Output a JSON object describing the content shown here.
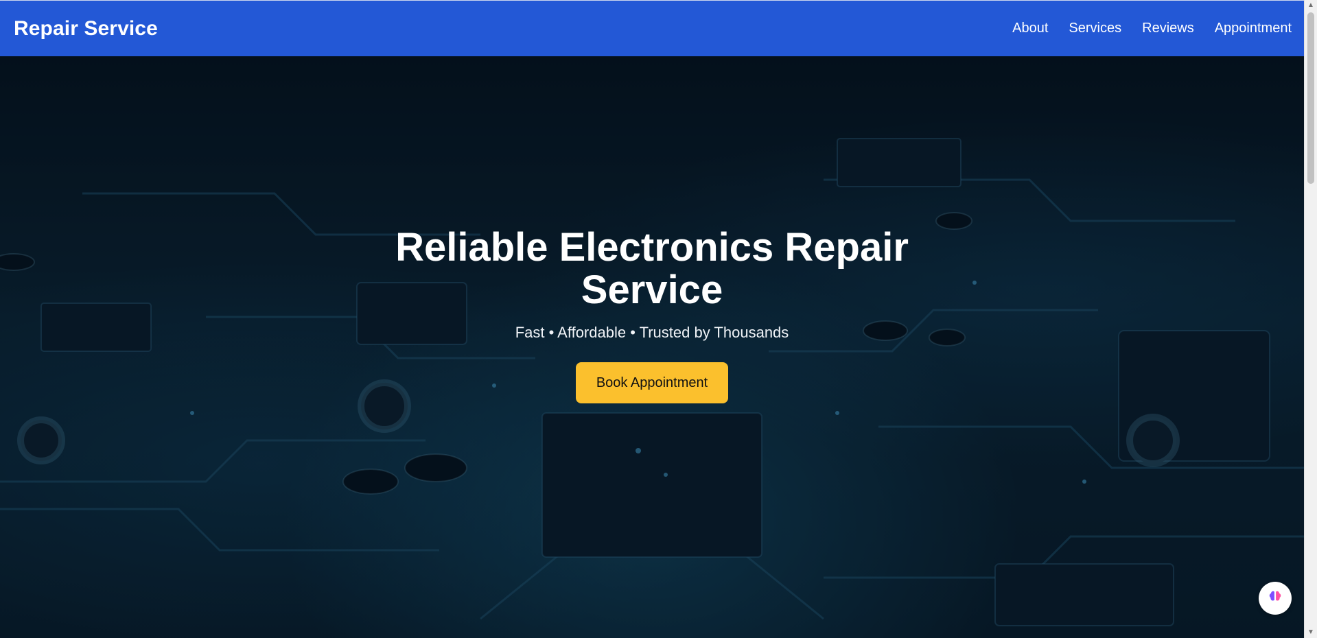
{
  "header": {
    "brand": "Repair Service",
    "nav": [
      {
        "label": "About"
      },
      {
        "label": "Services"
      },
      {
        "label": "Reviews"
      },
      {
        "label": "Appointment"
      }
    ]
  },
  "hero": {
    "title": "Reliable Electronics Repair Service",
    "tagline": "Fast • Affordable • Trusted by Thousands",
    "cta_label": "Book Appointment"
  },
  "widgets": {
    "floating_badge_icon": "brain-icon"
  },
  "colors": {
    "header_bg": "#2358d6",
    "cta_bg": "#fbc02d"
  }
}
